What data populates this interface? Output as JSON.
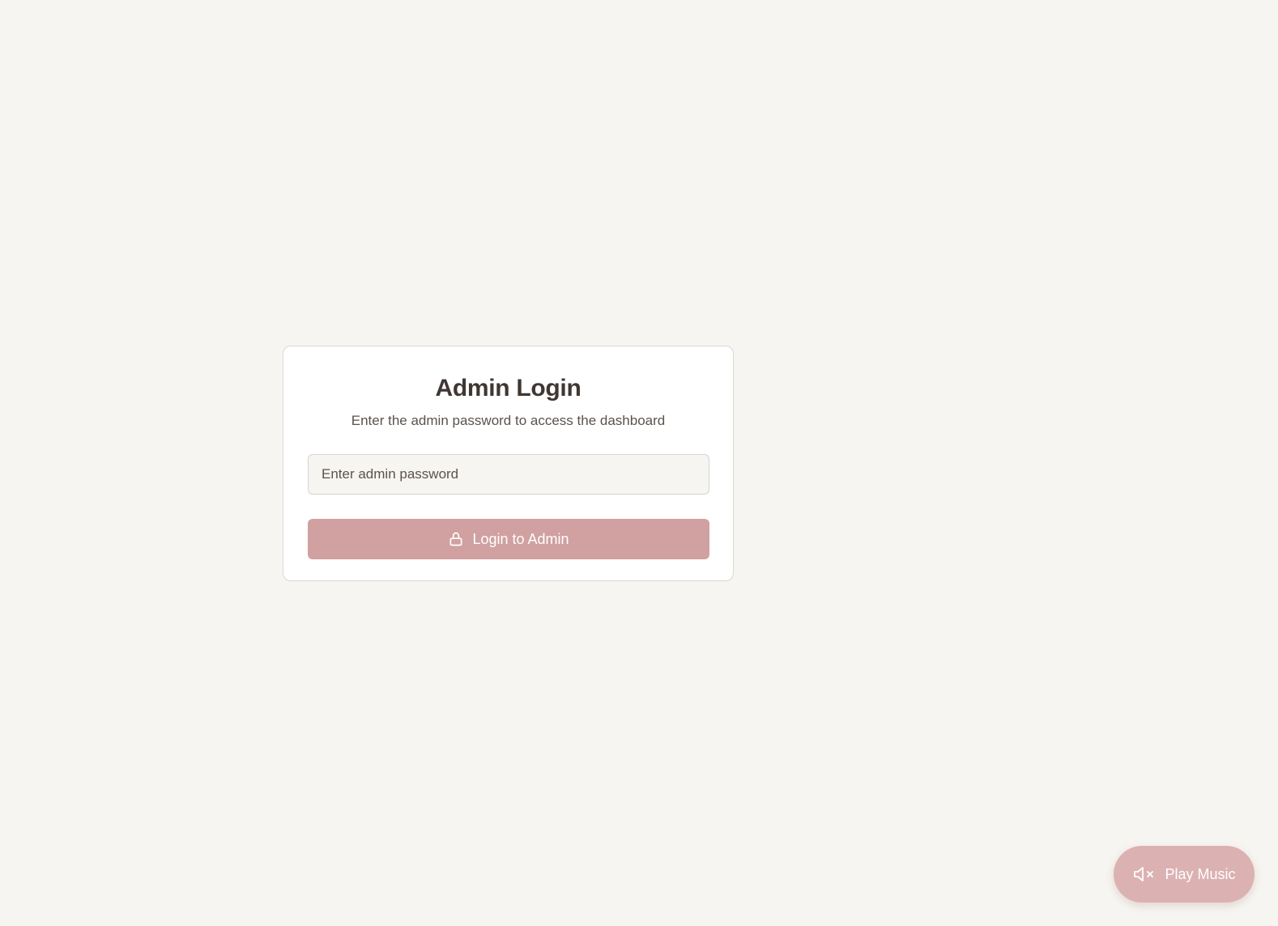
{
  "login": {
    "title": "Admin Login",
    "subtitle": "Enter the admin password to access the dashboard",
    "password_placeholder": "Enter admin password",
    "submit_label": "Login to Admin",
    "submit_icon": "lock-icon"
  },
  "music": {
    "label": "Play Music",
    "icon": "volume-muted-icon"
  },
  "colors": {
    "background": "#f7f5f1",
    "card": "#ffffff",
    "accent": "#d1a0a1",
    "music_button": "#dcb1b2",
    "text_primary": "#3f3733"
  }
}
